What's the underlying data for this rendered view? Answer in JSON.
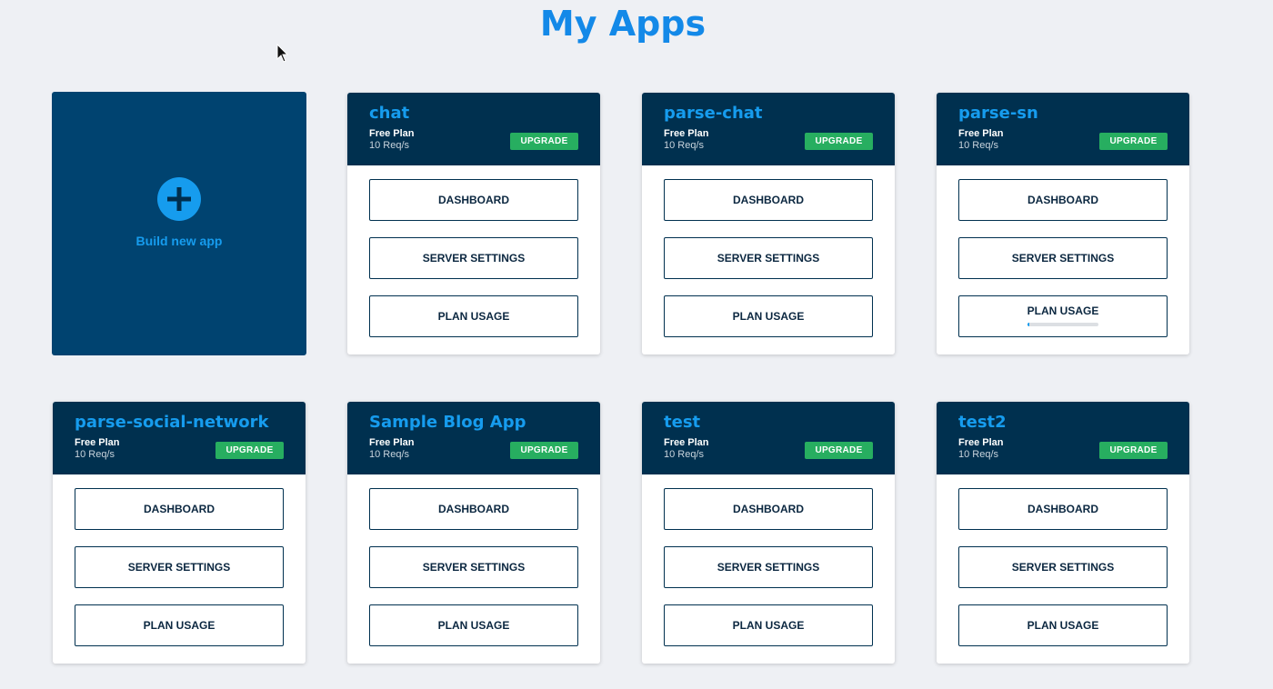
{
  "page": {
    "title": "My Apps"
  },
  "new_app": {
    "label": "Build new app"
  },
  "apps": [
    {
      "name": "chat",
      "plan": "Free Plan",
      "rate": "10 Req/s",
      "upgrade": "UPGRADE",
      "dashboard": "DASHBOARD",
      "server_settings": "SERVER SETTINGS",
      "plan_usage": "PLAN USAGE"
    },
    {
      "name": "parse-chat",
      "plan": "Free Plan",
      "rate": "10 Req/s",
      "upgrade": "UPGRADE",
      "dashboard": "DASHBOARD",
      "server_settings": "SERVER SETTINGS",
      "plan_usage": "PLAN USAGE"
    },
    {
      "name": "parse-sn",
      "plan": "Free Plan",
      "rate": "10 Req/s",
      "upgrade": "UPGRADE",
      "dashboard": "DASHBOARD",
      "server_settings": "SERVER SETTINGS",
      "plan_usage": "PLAN USAGE",
      "usage_fraction": 0.03
    },
    {
      "name": "parse-social-network",
      "plan": "Free Plan",
      "rate": "10 Req/s",
      "upgrade": "UPGRADE",
      "dashboard": "DASHBOARD",
      "server_settings": "SERVER SETTINGS",
      "plan_usage": "PLAN USAGE"
    },
    {
      "name": "Sample Blog App",
      "plan": "Free Plan",
      "rate": "10 Req/s",
      "upgrade": "UPGRADE",
      "dashboard": "DASHBOARD",
      "server_settings": "SERVER SETTINGS",
      "plan_usage": "PLAN USAGE"
    },
    {
      "name": "test",
      "plan": "Free Plan",
      "rate": "10 Req/s",
      "upgrade": "UPGRADE",
      "dashboard": "DASHBOARD",
      "server_settings": "SERVER SETTINGS",
      "plan_usage": "PLAN USAGE"
    },
    {
      "name": "test2",
      "plan": "Free Plan",
      "rate": "10 Req/s",
      "upgrade": "UPGRADE",
      "dashboard": "DASHBOARD",
      "server_settings": "SERVER SETTINGS",
      "plan_usage": "PLAN USAGE"
    }
  ],
  "colors": {
    "accent": "#169cee",
    "title": "#1389e8",
    "card_header": "#00304f",
    "new_app_bg": "#004370",
    "upgrade": "#27ae60",
    "background": "#eef0f4"
  },
  "icons": {
    "new_app": "plus-circle-icon",
    "cursor": "mouse-pointer-icon"
  }
}
